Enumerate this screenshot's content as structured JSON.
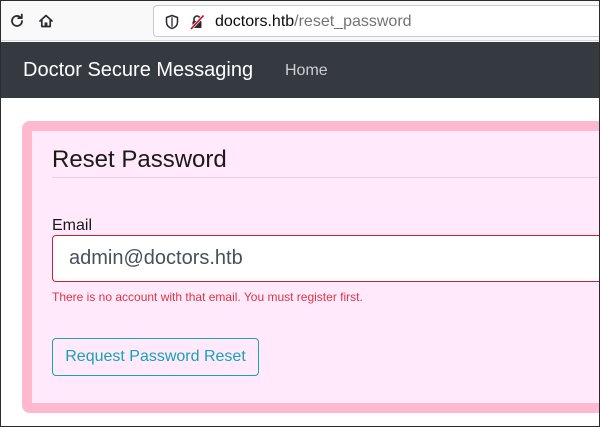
{
  "browser": {
    "url_host": "doctors.htb",
    "url_path": "/reset_password"
  },
  "navbar": {
    "brand": "Doctor Secure Messaging",
    "home_link": "Home"
  },
  "form": {
    "title": "Reset Password",
    "email_label": "Email",
    "email_value": "admin@doctors.htb",
    "error_message": "There is no account with that email. You must register first.",
    "submit_label": "Request Password Reset"
  },
  "colors": {
    "navbar_bg": "#343a40",
    "card_bg": "#ffe9fb",
    "card_border": "#ffb9ce",
    "error": "#dc3545",
    "button_accent": "#17a2b8"
  },
  "icons": {
    "reload": "reload-icon",
    "home": "home-icon",
    "shield": "shield-icon",
    "insecure_lock": "insecure-lock-icon"
  }
}
